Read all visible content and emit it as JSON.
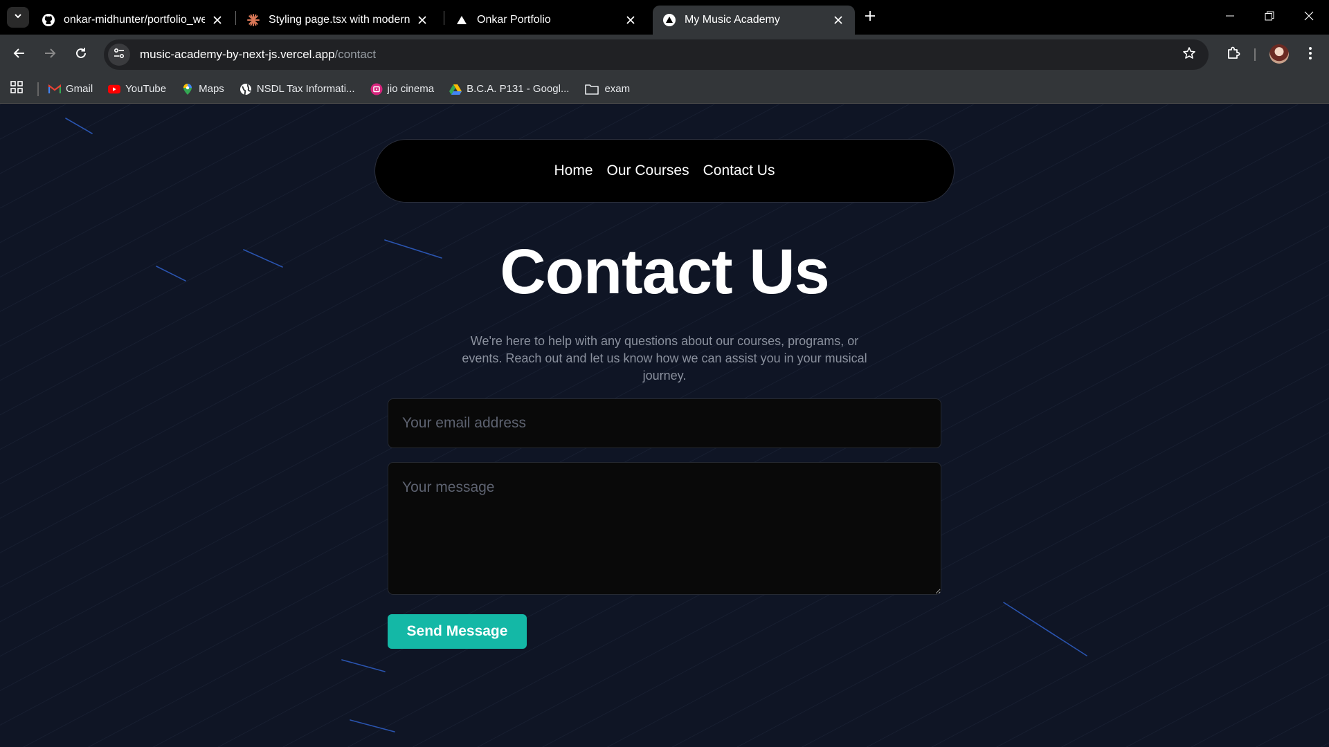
{
  "browser": {
    "tabs": [
      {
        "title": "onkar-midhunter/portfolio_web",
        "favicon": "github-icon",
        "active": false
      },
      {
        "title": "Styling page.tsx with modern pr",
        "favicon": "claude-icon",
        "active": false
      },
      {
        "title": "Onkar Portfolio",
        "favicon": "vercel-icon",
        "active": false
      },
      {
        "title": "My Music Academy",
        "favicon": "vercel-icon",
        "active": true
      }
    ],
    "url_host": "music-academy-by-next-js.vercel.app",
    "url_path": "/contact",
    "bookmarks": [
      {
        "label": "Gmail",
        "icon": "gmail-icon"
      },
      {
        "label": "YouTube",
        "icon": "youtube-icon"
      },
      {
        "label": "Maps",
        "icon": "maps-icon"
      },
      {
        "label": "NSDL Tax Informati...",
        "icon": "globe-icon"
      },
      {
        "label": "jio cinema",
        "icon": "jiocinema-icon"
      },
      {
        "label": "B.C.A. P131 - Googl...",
        "icon": "drive-icon"
      },
      {
        "label": "exam",
        "icon": "folder-icon"
      }
    ]
  },
  "nav": {
    "items": [
      "Home",
      "Our Courses",
      "Contact Us"
    ]
  },
  "contact": {
    "heading": "Contact Us",
    "subtitle": "We're here to help with any questions about our courses, programs, or events. Reach out and let us know how we can assist you in your musical journey.",
    "email_placeholder": "Your email address",
    "email_value": "",
    "message_placeholder": "Your message",
    "message_value": "",
    "send_label": "Send Message"
  },
  "colors": {
    "page_bg": "#0f1525",
    "accent": "#14b8a6",
    "navbar_bg": "#000000"
  }
}
